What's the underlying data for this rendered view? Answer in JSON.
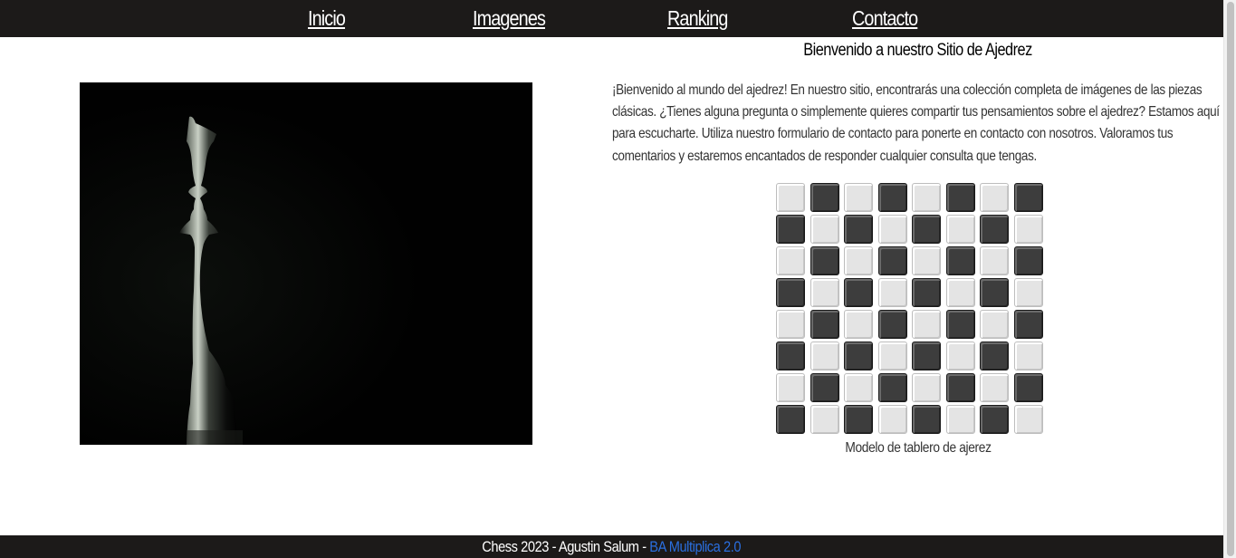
{
  "nav": {
    "items": [
      {
        "label": "Inicio"
      },
      {
        "label": "Imagenes"
      },
      {
        "label": "Ranking"
      },
      {
        "label": "Contacto"
      }
    ]
  },
  "main": {
    "title": "Bienvenido a nuestro Sitio de Ajedrez",
    "intro": "¡Bienvenido al mundo del ajedrez! En nuestro sitio, encontrarás una colección completa de imágenes de las piezas clásicas. ¿Tienes alguna pregunta o simplemente quieres compartir tus pensamientos sobre el ajedrez? Estamos aquí para escucharte. Utiliza nuestro formulario de contacto para ponerte en contacto con nosotros. Valoramos tus comentarios y estaremos encantados de responder cualquier consulta que tengas.",
    "board_caption": "Modelo de tablero de ajerez",
    "board": {
      "rows": 8,
      "cols": 8,
      "light_color": "#e4e4e4",
      "dark_color": "#3d3d3d"
    }
  },
  "footer": {
    "text": "Chess 2023 - Agustin Salum - ",
    "link_label": "BA Multiplica 2.0",
    "link_color": "#2a6fe0"
  },
  "colors": {
    "nav_bg": "#1c1a19",
    "nav_text": "#ffffff",
    "body_text": "#333333"
  }
}
